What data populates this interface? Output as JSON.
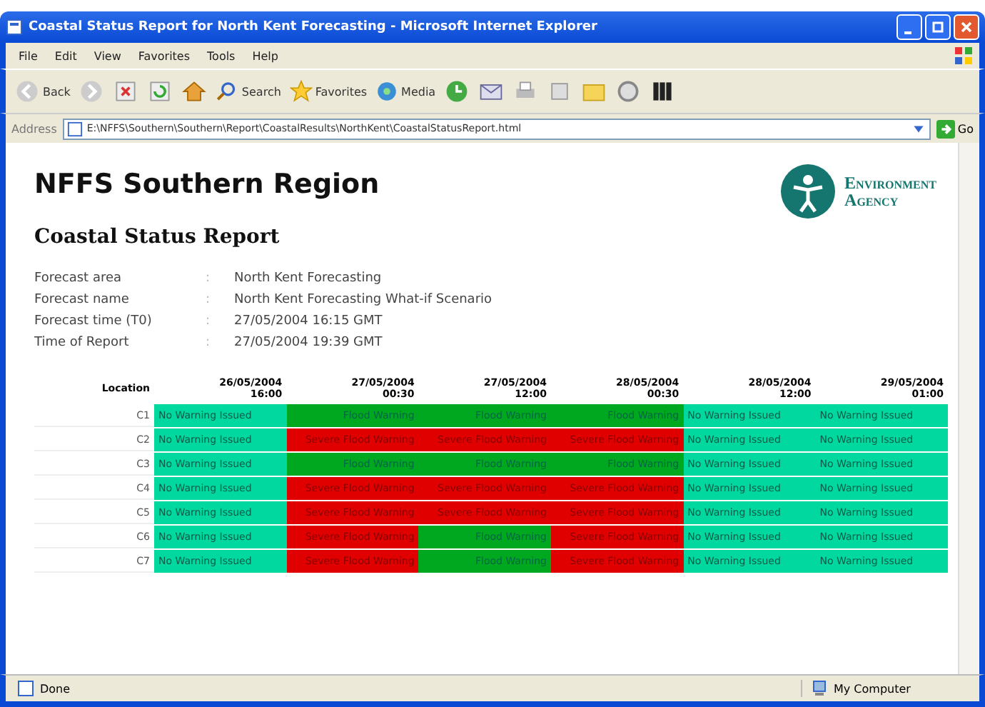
{
  "window": {
    "title": "Coastal Status Report for North Kent Forecasting - Microsoft Internet Explorer"
  },
  "menu": [
    "File",
    "Edit",
    "View",
    "Favorites",
    "Tools",
    "Help"
  ],
  "toolbar": {
    "back": "Back",
    "search": "Search",
    "favorites": "Favorites",
    "media": "Media"
  },
  "address": {
    "label": "Address",
    "value": "E:\\NFFS\\Southern\\Southern\\Report\\CoastalResults\\NorthKent\\CoastalStatusReport.html",
    "go": "Go"
  },
  "page": {
    "heading": "NFFS Southern Region",
    "logo_line_1": "Environment",
    "logo_line_2": "Agency",
    "subheading": "Coastal Status Report",
    "details": [
      {
        "label": "Forecast area",
        "sep": ":",
        "value": "North Kent Forecasting"
      },
      {
        "label": "Forecast name",
        "sep": ":",
        "value": "North Kent Forecasting What-if Scenario"
      },
      {
        "label": "Forecast time (T0)",
        "sep": ":",
        "value": "27/05/2004 16:15 GMT"
      },
      {
        "label": "Time of Report",
        "sep": ":",
        "value": "27/05/2004 19:39 GMT"
      }
    ],
    "table": {
      "corner": "Location",
      "columns": [
        "26/05/2004 16:00",
        "27/05/2004 00:30",
        "27/05/2004 12:00",
        "28/05/2004 00:30",
        "28/05/2004 12:00",
        "29/05/2004 01:00"
      ],
      "rows": [
        {
          "location": "C1",
          "cells": [
            {
              "kind": "none",
              "text": "No Warning Issued"
            },
            {
              "kind": "flood",
              "text": "Flood Warning"
            },
            {
              "kind": "flood",
              "text": "Flood Warning"
            },
            {
              "kind": "flood",
              "text": "Flood Warning"
            },
            {
              "kind": "none",
              "text": "No Warning Issued"
            },
            {
              "kind": "none",
              "text": "No Warning Issued"
            }
          ]
        },
        {
          "location": "C2",
          "cells": [
            {
              "kind": "none",
              "text": "No Warning Issued"
            },
            {
              "kind": "severe",
              "text": "Severe Flood Warning"
            },
            {
              "kind": "severe",
              "text": "Severe Flood Warning"
            },
            {
              "kind": "severe",
              "text": "Severe Flood Warning"
            },
            {
              "kind": "none",
              "text": "No Warning Issued"
            },
            {
              "kind": "none",
              "text": "No Warning Issued"
            }
          ]
        },
        {
          "location": "C3",
          "cells": [
            {
              "kind": "none",
              "text": "No Warning Issued"
            },
            {
              "kind": "flood",
              "text": "Flood Warning"
            },
            {
              "kind": "flood",
              "text": "Flood Warning"
            },
            {
              "kind": "flood",
              "text": "Flood Warning"
            },
            {
              "kind": "none",
              "text": "No Warning Issued"
            },
            {
              "kind": "none",
              "text": "No Warning Issued"
            }
          ]
        },
        {
          "location": "C4",
          "cells": [
            {
              "kind": "none",
              "text": "No Warning Issued"
            },
            {
              "kind": "severe",
              "text": "Severe Flood Warning"
            },
            {
              "kind": "severe",
              "text": "Severe Flood Warning"
            },
            {
              "kind": "severe",
              "text": "Severe Flood Warning"
            },
            {
              "kind": "none",
              "text": "No Warning Issued"
            },
            {
              "kind": "none",
              "text": "No Warning Issued"
            }
          ]
        },
        {
          "location": "C5",
          "cells": [
            {
              "kind": "none",
              "text": "No Warning Issued"
            },
            {
              "kind": "severe",
              "text": "Severe Flood Warning"
            },
            {
              "kind": "severe",
              "text": "Severe Flood Warning"
            },
            {
              "kind": "severe",
              "text": "Severe Flood Warning"
            },
            {
              "kind": "none",
              "text": "No Warning Issued"
            },
            {
              "kind": "none",
              "text": "No Warning Issued"
            }
          ]
        },
        {
          "location": "C6",
          "cells": [
            {
              "kind": "none",
              "text": "No Warning Issued"
            },
            {
              "kind": "severe",
              "text": "Severe Flood Warning"
            },
            {
              "kind": "flood",
              "text": "Flood Warning"
            },
            {
              "kind": "severe",
              "text": "Severe Flood Warning"
            },
            {
              "kind": "none",
              "text": "No Warning Issued"
            },
            {
              "kind": "none",
              "text": "No Warning Issued"
            }
          ]
        },
        {
          "location": "C7",
          "cells": [
            {
              "kind": "none",
              "text": "No Warning Issued"
            },
            {
              "kind": "severe",
              "text": "Severe Flood Warning"
            },
            {
              "kind": "flood",
              "text": "Flood Warning"
            },
            {
              "kind": "severe",
              "text": "Severe Flood Warning"
            },
            {
              "kind": "none",
              "text": "No Warning Issued"
            },
            {
              "kind": "none",
              "text": "No Warning Issued"
            }
          ]
        }
      ]
    }
  },
  "status_bar": {
    "left": "Done",
    "right": "My Computer"
  }
}
